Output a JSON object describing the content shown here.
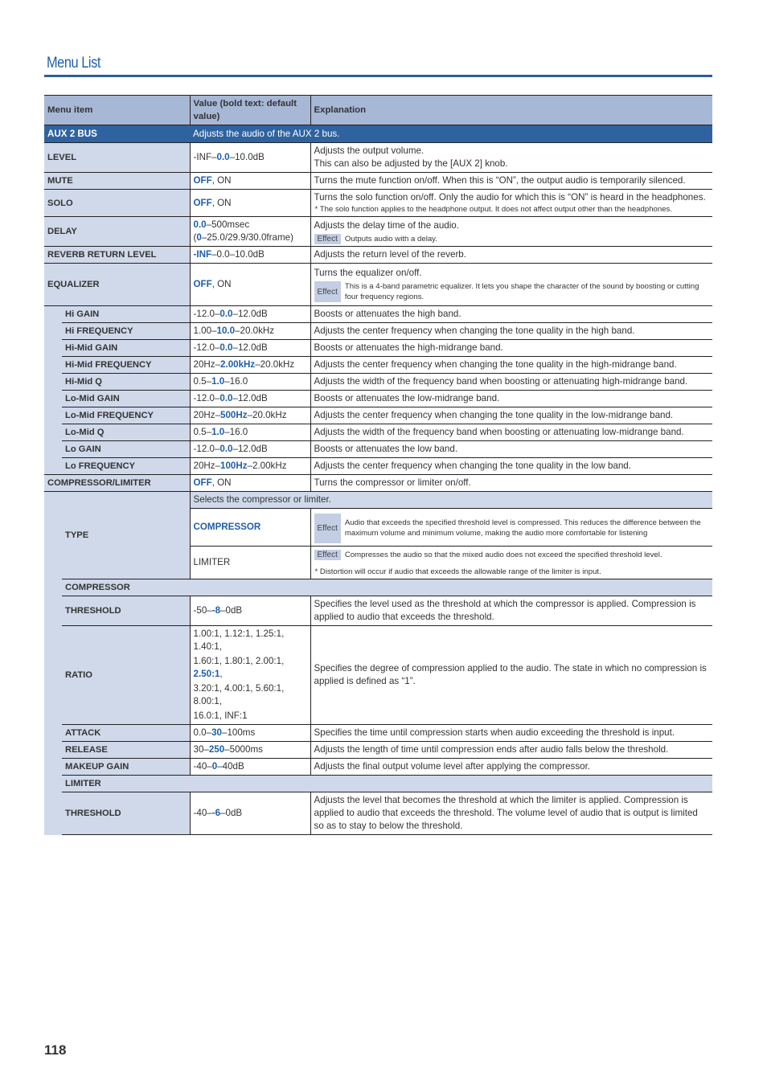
{
  "page": {
    "title": "Menu List",
    "page_number": "118"
  },
  "colors": {
    "accent": "#1f5fa8",
    "section_bg": "#2f63a0",
    "header_bg": "#a7b7d6",
    "item_bg": "#cfd9ea"
  },
  "table": {
    "headers": [
      "Menu item",
      "Value (bold text: default value)",
      "Explanation"
    ],
    "effect_label": "Effect",
    "section": {
      "name": "AUX 2 BUS",
      "description": "Adjusts the audio of the AUX 2 bus."
    },
    "rows": {
      "level": {
        "item": "LEVEL",
        "v1": "-INF–",
        "vb": "0.0",
        "v2": "–10.0dB",
        "exp1": "Adjusts the output volume.",
        "exp2": "This can also be adjusted by the [AUX 2] knob."
      },
      "mute": {
        "item": "MUTE",
        "vb": "OFF",
        "v2": ", ON",
        "exp": "Turns the mute function on/off. When this is “ON”, the output audio is temporarily silenced."
      },
      "solo": {
        "item": "SOLO",
        "vb": "OFF",
        "v2": ", ON",
        "exp": "Turns the solo function on/off. Only the audio for which this is “ON” is heard in the headphones.",
        "note": "* The solo function applies to the headphone output. It does not affect output other than the headphones."
      },
      "delay": {
        "item": "DELAY",
        "vb": "0.0",
        "v2": "–500msec",
        "v3a": "(",
        "v3b": "0",
        "v3c": "–25.0/29.9/30.0frame)",
        "exp": "Adjusts the delay time of the audio.",
        "effect": "Outputs audio with a delay."
      },
      "reverb": {
        "item": "REVERB RETURN LEVEL",
        "vb": "-INF",
        "v2": "–0.0–10.0dB",
        "exp": "Adjusts the return level of the reverb."
      },
      "eq": {
        "item": "EQUALIZER",
        "vb": "OFF",
        "v2": ", ON",
        "exp": "Turns the equalizer on/off.",
        "effect": "This is a 4-band parametric equalizer. It lets you shape the character of the sound by boosting or cutting four frequency regions."
      },
      "eq_sub": [
        {
          "item": "Hi GAIN",
          "v1": "-12.0–",
          "vb": "0.0",
          "v2": "–12.0dB",
          "exp": "Boosts or attenuates the high band."
        },
        {
          "item": "Hi FREQUENCY",
          "v1": "1.00–",
          "vb": "10.0",
          "v2": "–20.0kHz",
          "exp": "Adjusts the center frequency when changing the tone quality in the high band."
        },
        {
          "item": "Hi-Mid GAIN",
          "v1": "-12.0–",
          "vb": "0.0",
          "v2": "–12.0dB",
          "exp": "Boosts or attenuates the high-midrange band."
        },
        {
          "item": "Hi-Mid FREQUENCY",
          "v1": "20Hz–",
          "vb": "2.00kHz",
          "v2": "–20.0kHz",
          "exp": "Adjusts the center frequency when changing the tone quality in the high-midrange band."
        },
        {
          "item": "Hi-Mid Q",
          "v1": "0.5–",
          "vb": "1.0",
          "v2": "–16.0",
          "exp": "Adjusts the width of the frequency band when boosting or attenuating high-midrange band."
        },
        {
          "item": "Lo-Mid GAIN",
          "v1": "-12.0–",
          "vb": "0.0",
          "v2": "–12.0dB",
          "exp": "Boosts or attenuates the low-midrange band."
        },
        {
          "item": "Lo-Mid FREQUENCY",
          "v1": "20Hz–",
          "vb": "500Hz",
          "v2": "–20.0kHz",
          "exp": "Adjusts the center frequency when changing the tone quality in the low-midrange band."
        },
        {
          "item": "Lo-Mid Q",
          "v1": "0.5–",
          "vb": "1.0",
          "v2": "–16.0",
          "exp": "Adjusts the width of the frequency band when boosting or attenuating low-midrange band."
        },
        {
          "item": "Lo GAIN",
          "v1": "-12.0–",
          "vb": "0.0",
          "v2": "–12.0dB",
          "exp": "Boosts or attenuates the low band."
        },
        {
          "item": "Lo FREQUENCY",
          "v1": "20Hz–",
          "vb": "100Hz",
          "v2": "–2.00kHz",
          "exp": "Adjusts the center frequency when changing the tone quality in the low band."
        }
      ],
      "comp": {
        "item": "COMPRESSOR/LIMITER",
        "vb": "OFF",
        "v2": ", ON",
        "exp": "Turns the compressor or limiter on/off."
      },
      "type": {
        "item": "TYPE",
        "desc": "Selects the compressor or limiter.",
        "compressor": {
          "value": "COMPRESSOR",
          "effect": "Audio that exceeds the specified threshold level is compressed. This reduces the difference between the maximum volume and minimum volume, making the audio more comfortable for listening"
        },
        "limiter": {
          "value": "LIMITER",
          "effect": "Compresses the audio so that the mixed audio does not exceed the specified threshold level.",
          "note": "* Distortion will occur if audio that exceeds the allowable range of the limiter is input."
        }
      },
      "compressor_band": "COMPRESSOR",
      "c_threshold": {
        "item": "THRESHOLD",
        "v1": "-50–",
        "vb": "-8",
        "v2": "–0dB",
        "exp": "Specifies the level used as the threshold at which the compressor is applied. Compression is applied to audio that exceeds the threshold."
      },
      "ratio": {
        "item": "RATIO",
        "l1": "1.00:1, 1.12:1, 1.25:1, 1.40:1,",
        "l2": "1.60:1, 1.80:1, 2.00:1, ",
        "l2b": "2.50:1",
        "l2c": ",",
        "l3": "3.20:1, 4.00:1, 5.60:1, 8.00:1,",
        "l4": "16.0:1, INF:1",
        "exp": "Specifies the degree of compression applied to the audio. The state in which no compression is applied is defined as “1”."
      },
      "attack": {
        "item": "ATTACK",
        "v1": "0.0–",
        "vb": "30",
        "v2": "–100ms",
        "exp": "Specifies the time until compression starts when audio exceeding the threshold is input."
      },
      "release": {
        "item": "RELEASE",
        "v1": "30–",
        "vb": "250",
        "v2": "–5000ms",
        "exp": "Adjusts the length of time until compression ends after audio falls below the threshold."
      },
      "makeup": {
        "item": "MAKEUP GAIN",
        "v1": "-40–",
        "vb": "0",
        "v2": "–40dB",
        "exp": "Adjusts the final output volume level after applying the compressor."
      },
      "limiter_band": "LIMITER",
      "l_threshold": {
        "item": "THRESHOLD",
        "v1": "-40–",
        "vb": "-6",
        "v2": "–0dB",
        "exp": "Adjusts the level that becomes the threshold at which the limiter is applied. Compression is applied to audio that exceeds the threshold. The volume level of audio that is output is limited so as to stay to below the threshold."
      }
    }
  }
}
